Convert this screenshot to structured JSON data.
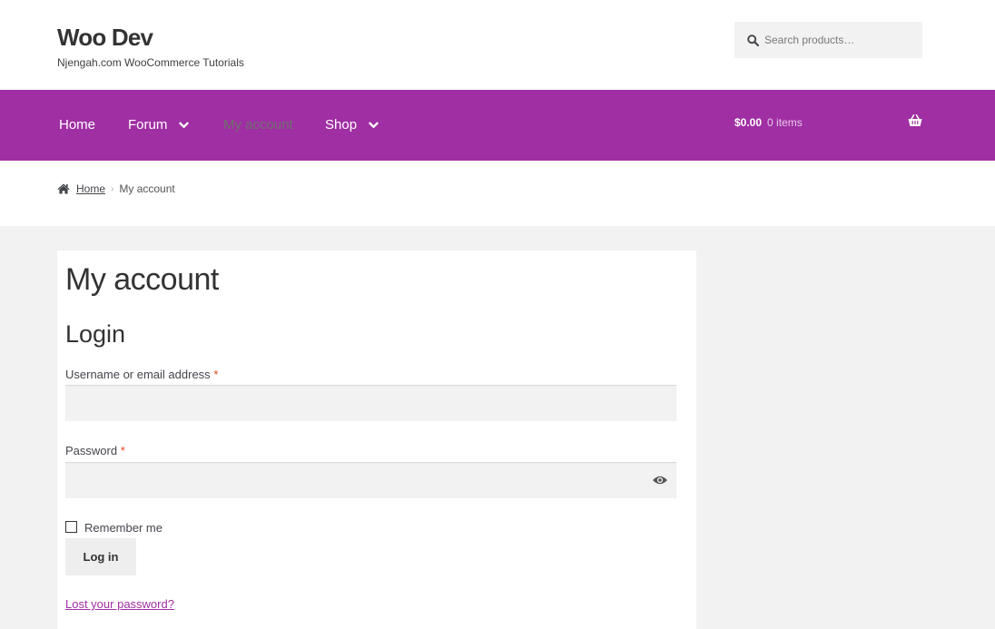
{
  "header": {
    "site_title": "Woo Dev",
    "tagline": "Njengah.com WooCommerce Tutorials",
    "search_placeholder": "Search products…"
  },
  "nav": {
    "items": [
      {
        "label": "Home",
        "has_dropdown": false,
        "current": false
      },
      {
        "label": "Forum",
        "has_dropdown": true,
        "current": false
      },
      {
        "label": "My account",
        "has_dropdown": false,
        "current": true
      },
      {
        "label": "Shop",
        "has_dropdown": true,
        "current": false
      }
    ],
    "cart_amount": "$0.00",
    "cart_count": "0 items",
    "icons": {
      "dropdown": "chevron-down-icon",
      "cart": "basket-icon"
    }
  },
  "breadcrumb": {
    "home_label": "Home",
    "current_label": "My account",
    "icons": {
      "home": "home-icon",
      "separator": "chevron-right-icon"
    }
  },
  "main": {
    "page_title": "My account",
    "login_heading": "Login",
    "username_label": "Username or email address",
    "password_label": "Password",
    "required_mark": "*",
    "username_value": "",
    "password_value": "",
    "remember_label": "Remember me",
    "remember_checked": false,
    "login_button": "Log in",
    "lost_password": "Lost your password?"
  },
  "colors": {
    "brand_purple": "#a02fa3",
    "background": "#f2f2f2",
    "text": "#43454b",
    "required": "#e2401c"
  }
}
